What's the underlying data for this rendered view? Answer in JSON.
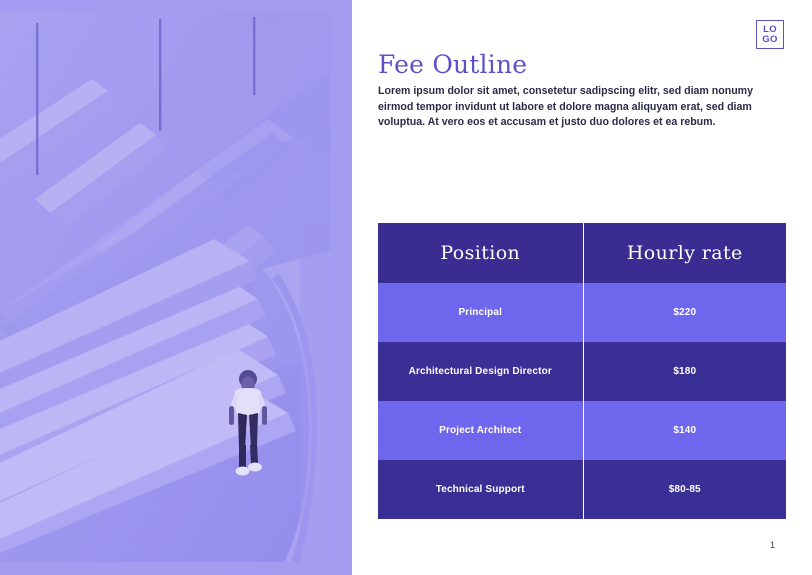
{
  "slide": {
    "page_number": "1",
    "background_color": "#ffffff"
  },
  "logo": {
    "line1": "LO",
    "line2": "GO",
    "color": "#5b51c9"
  },
  "header": {
    "title": "Fee Outline",
    "title_color": "#5b51c9",
    "subtitle": "Lorem ipsum dolor sit amet, consetetur sadipscing elitr, sed diam nonumy eirmod tempor invidunt ut labore et dolore magna aliquyam erat, sed diam voluptua. At vero eos et accusam et justo duo dolores et ea rebum.",
    "subtitle_color": "#2b2b48"
  },
  "photo": {
    "alt": "staircase-photo",
    "description": "Duotone purple photograph of a modern white staircase with a person walking down the steps",
    "tint_color": "#8b83ea",
    "frame_color": "#a39cf0"
  },
  "fee_table": {
    "header_color": "#392d92",
    "row_light_color": "#6e66ec",
    "row_dark_color": "#3a2f95",
    "columns": [
      "Position",
      "Hourly rate"
    ],
    "rows": [
      {
        "position": "Principal",
        "rate": "$220"
      },
      {
        "position": "Architectural Design Director",
        "rate": "$180"
      },
      {
        "position": "Project Architect",
        "rate": "$140"
      },
      {
        "position": "Technical Support",
        "rate": "$80-85"
      }
    ]
  }
}
